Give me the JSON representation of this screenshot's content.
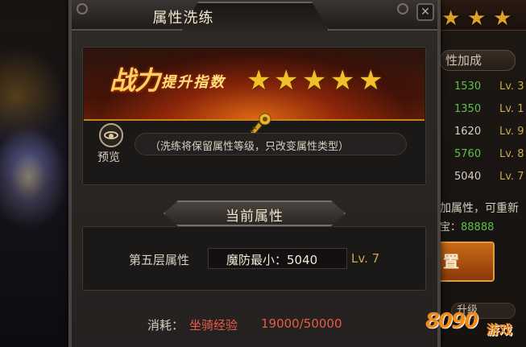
{
  "dialog": {
    "title": "属性洗练"
  },
  "banner": {
    "power_text": "战力",
    "power_sub": "提升指数",
    "star_count": 5
  },
  "preview": {
    "label": "预览",
    "hint": "（洗练将保留属性等级，只改变属性类型）"
  },
  "current": {
    "tab_label": "当前属性",
    "attr_label": "第五层属性",
    "attr_value": "魔防最小：5040",
    "attr_level": "Lv. 7"
  },
  "cost": {
    "label": "消耗：",
    "item": "坐骑经验",
    "amount": "19000/50000"
  },
  "background_panel": {
    "header": "性加成",
    "rows": [
      {
        "value": "1530",
        "level": "Lv. 3"
      },
      {
        "value": "1350",
        "level": "Lv. 1"
      },
      {
        "value": "1620",
        "level": "Lv. 9"
      },
      {
        "value": "5760",
        "level": "Lv. 8"
      },
      {
        "value": "5040",
        "level": "Lv. 7"
      }
    ],
    "note": "加属性，可重新",
    "gold_prefix": "宝：",
    "gold_value": "88888",
    "button": "置",
    "sub_header": "升级"
  },
  "watermark": {
    "number": "8090",
    "text": "游戏"
  },
  "colors": {
    "green": "#5cc04a",
    "gold": "#c9a74a",
    "red": "#e85a4a",
    "star": "#f2c02a"
  }
}
